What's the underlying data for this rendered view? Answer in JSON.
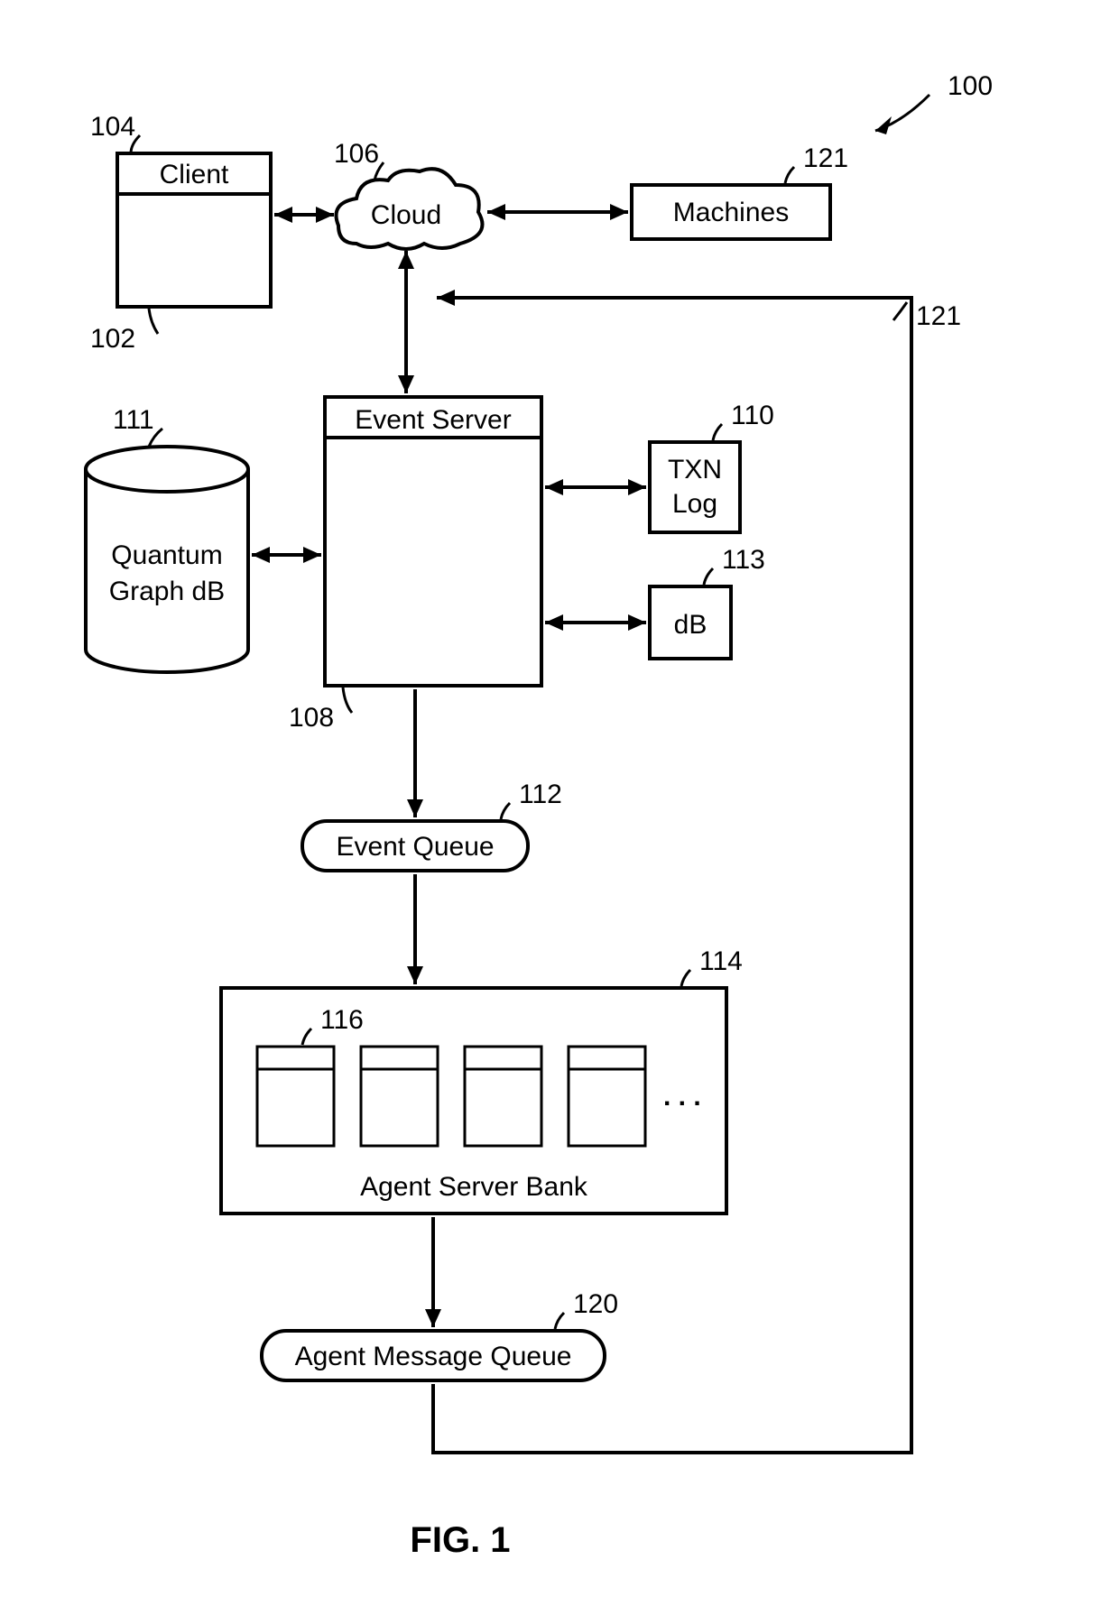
{
  "figure_ref": "100",
  "figure_caption": "FIG. 1",
  "nodes": {
    "client": {
      "label": "Client",
      "ref": "104",
      "container_ref": "102"
    },
    "cloud": {
      "label": "Cloud",
      "ref": "106"
    },
    "machines": {
      "label": "Machines",
      "ref": "121"
    },
    "feedback": {
      "ref": "121"
    },
    "event_server": {
      "label": "Event Server",
      "ref": "108"
    },
    "quantum_db": {
      "label_top": "Quantum",
      "label_bottom": "Graph dB",
      "ref": "111"
    },
    "txn_log": {
      "label_top": "TXN",
      "label_bottom": "Log",
      "ref": "110"
    },
    "db": {
      "label": "dB",
      "ref": "113"
    },
    "event_queue": {
      "label": "Event Queue",
      "ref": "112"
    },
    "agent_bank": {
      "label": "Agent Server Bank",
      "ref": "114",
      "unit_ref": "116",
      "ellipsis": ". . ."
    },
    "agent_mq": {
      "label": "Agent Message Queue",
      "ref": "120"
    }
  }
}
